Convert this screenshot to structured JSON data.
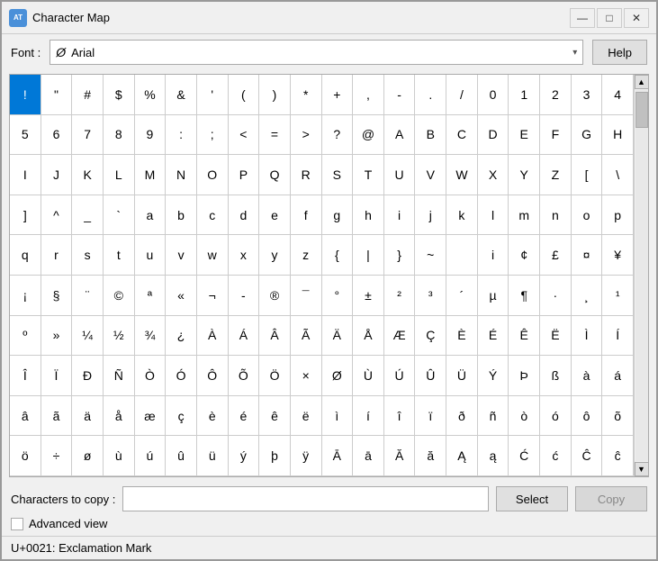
{
  "window": {
    "title": "Character Map",
    "icon_label": "AT"
  },
  "title_controls": {
    "minimize": "—",
    "maximize": "□",
    "close": "✕"
  },
  "toolbar": {
    "font_label": "Font :",
    "font_name": "Arial",
    "font_prefix": "Ø",
    "help_label": "Help"
  },
  "chars_row": {
    "label": "Characters to copy :",
    "input_value": "",
    "select_label": "Select",
    "copy_label": "Copy"
  },
  "advanced": {
    "label": "Advanced view"
  },
  "status": {
    "text": "U+0021: Exclamation Mark"
  },
  "characters": [
    "!",
    "\"",
    "#",
    "$",
    "%",
    "&",
    "'",
    "(",
    ")",
    "*",
    "+",
    ",",
    "-",
    ".",
    "/",
    "0",
    "1",
    "2",
    "3",
    "4",
    "5",
    "6",
    "7",
    "8",
    "9",
    ":",
    ";",
    "<",
    "=",
    ">",
    "?",
    "@",
    "A",
    "B",
    "C",
    "D",
    "E",
    "F",
    "G",
    "H",
    "I",
    "J",
    "K",
    "L",
    "M",
    "N",
    "O",
    "P",
    "Q",
    "R",
    "S",
    "T",
    "U",
    "V",
    "W",
    "X",
    "Y",
    "Z",
    "[",
    "\\",
    "]",
    "^",
    "_",
    "`",
    "a",
    "b",
    "c",
    "d",
    "e",
    "f",
    "g",
    "h",
    "i",
    "j",
    "k",
    "l",
    "m",
    "n",
    "o",
    "p",
    "q",
    "r",
    "s",
    "t",
    "u",
    "v",
    "w",
    "x",
    "y",
    "z",
    "{",
    "|",
    "}",
    "~",
    " ",
    "i",
    "¢",
    "£",
    "¤",
    "¥",
    "¡",
    "§",
    "¨",
    "©",
    "ª",
    "«",
    "¬",
    "-",
    "®",
    "¯",
    "°",
    "±",
    "²",
    "³",
    "´",
    "µ",
    "¶",
    "·",
    "¸",
    "¹",
    "º",
    "»",
    "¼",
    "½",
    "¾",
    "¿",
    "À",
    "Á",
    "Â",
    "Ã",
    "Ä",
    "Å",
    "Æ",
    "Ç",
    "È",
    "É",
    "Ê",
    "Ë",
    "Ì",
    "Í",
    "Î",
    "Ï",
    "Ð",
    "Ñ",
    "Ò",
    "Ó",
    "Ô",
    "Õ",
    "Ö",
    "×",
    "Ø",
    "Ù",
    "Ú",
    "Û",
    "Ü",
    "Ý",
    "Þ",
    "ß",
    "à",
    "á",
    "â",
    "ã",
    "ä",
    "å",
    "æ",
    "ç",
    "è",
    "é",
    "ê",
    "ë",
    "ì",
    "í",
    "î",
    "ï",
    "ð",
    "ñ",
    "ò",
    "ó",
    "ô",
    "õ",
    "ö",
    "÷",
    "ø",
    "ù",
    "ú",
    "û",
    "ü",
    "ý",
    "þ",
    "ÿ",
    "Ā",
    "ā",
    "Ă",
    "ă",
    "Ą",
    "ą",
    "Ć",
    "ć",
    "Ĉ",
    "ĉ"
  ]
}
